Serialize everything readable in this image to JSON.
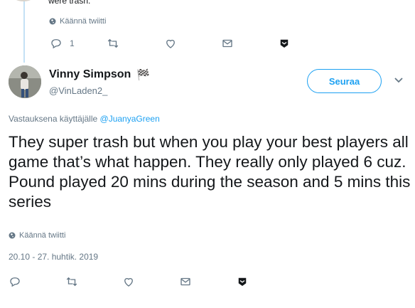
{
  "parent_tweet": {
    "text_fragment": "were trash.",
    "translate_label": "Käännä twiitti",
    "reply_count": "1"
  },
  "tweet": {
    "author_name": "Vinny Simpson",
    "author_flag": "🏁",
    "author_handle": "@VinLaden2_",
    "follow_label": "Seuraa",
    "reply_prefix": "Vastauksena käyttäjälle",
    "reply_target": "@JuanyaGreen",
    "text": "They super trash but when you play your best players all game that’s what happen. They really only played 6 cuz. Pound played 20 mins during the season and 5 mins this series",
    "translate_label": "Käännä twiitti",
    "timestamp": "20.10 - 27. huhtik. 2019"
  },
  "icons": [
    "reply-icon",
    "retweet-icon",
    "like-icon",
    "message-icon",
    "share-icon",
    "globe-icon",
    "chevron-down-icon"
  ],
  "colors": {
    "accent": "#1da1f2",
    "muted": "#657786",
    "text": "#14171a",
    "thread": "#c4e1f5"
  }
}
